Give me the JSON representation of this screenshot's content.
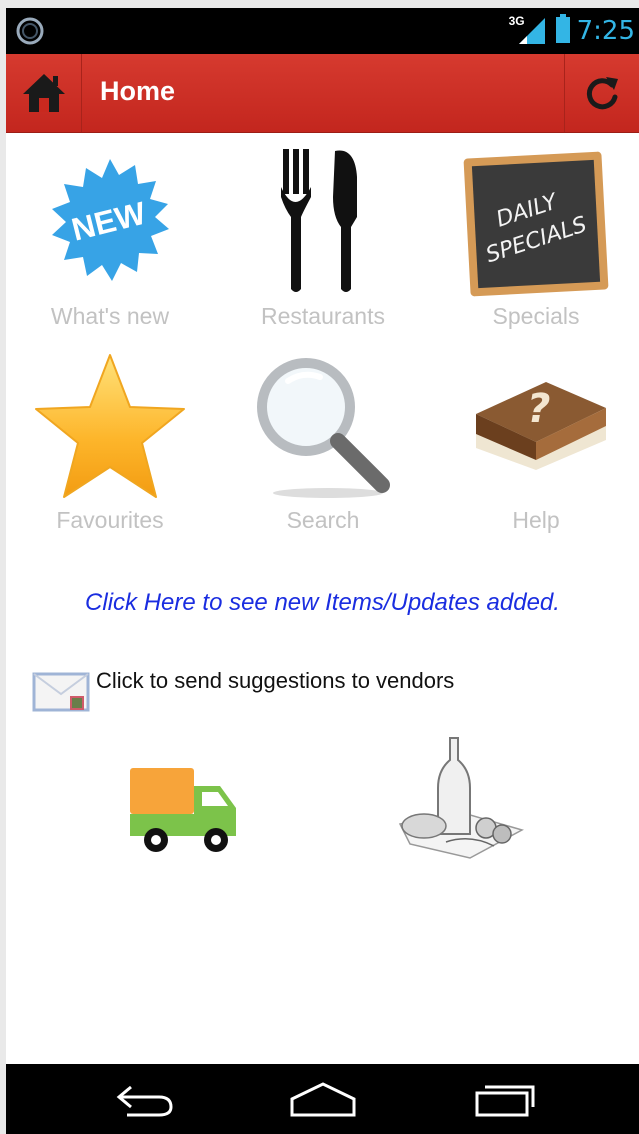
{
  "status_bar": {
    "network": "3G",
    "time": "7:25"
  },
  "app_bar": {
    "title": "Home",
    "home_icon": "home-icon",
    "refresh_icon": "refresh-icon",
    "accent": "#c9291f"
  },
  "tiles": [
    {
      "label": "What's new",
      "icon": "new-badge-icon"
    },
    {
      "label": "Restaurants",
      "icon": "fork-knife-icon"
    },
    {
      "label": "Specials",
      "icon": "chalkboard-icon"
    },
    {
      "label": "Favourites",
      "icon": "star-icon"
    },
    {
      "label": "Search",
      "icon": "magnifier-icon"
    },
    {
      "label": "Help",
      "icon": "help-book-icon"
    }
  ],
  "updates_link": "Click Here to see new Items/Updates added.",
  "suggestions": {
    "text": "Click to send suggestions to vendors",
    "icon": "envelope-icon"
  },
  "vendor_icons": [
    "delivery-truck-icon",
    "groceries-icon"
  ],
  "chalkboard_text": [
    "DAILY",
    "SPECIALS"
  ],
  "new_badge_text": "NEW",
  "nav_bar": {
    "back_icon": "back-icon",
    "home_icon": "nav-home-icon",
    "recents_icon": "recent-apps-icon"
  }
}
